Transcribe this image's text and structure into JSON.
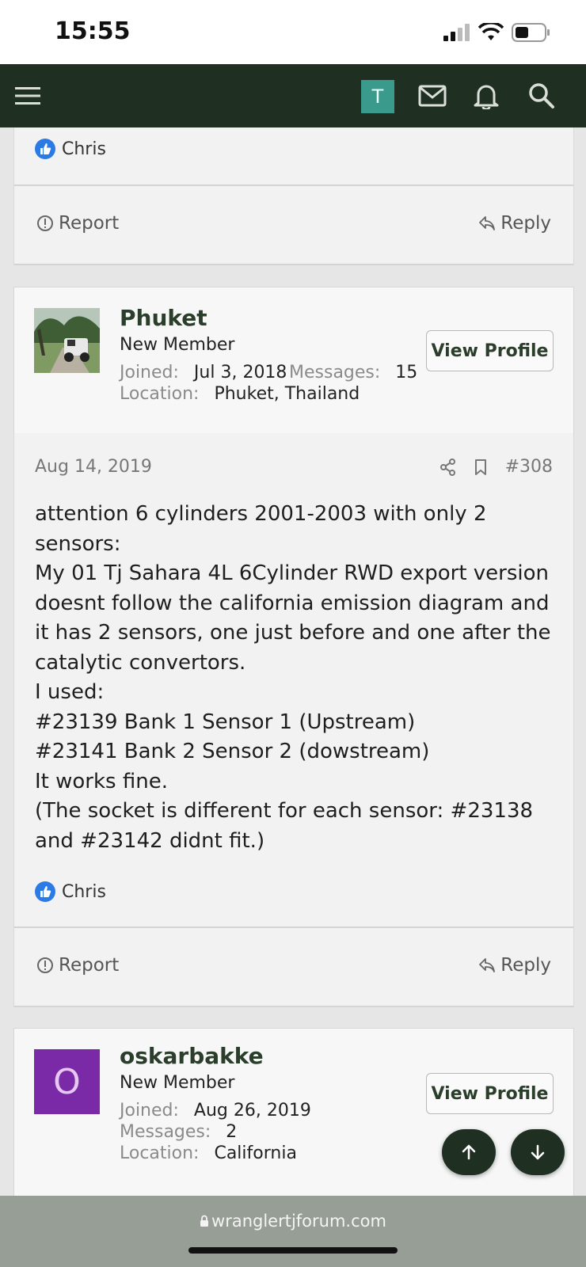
{
  "status": {
    "time": "15:55"
  },
  "header": {
    "user_initial": "T"
  },
  "prev_post": {
    "like_user": "Chris",
    "report_label": "Report",
    "reply_label": "Reply"
  },
  "post": {
    "author": {
      "name": "Phuket",
      "title": "New Member",
      "joined_label": "Joined:",
      "joined": "Jul 3, 2018",
      "messages_label": "Messages:",
      "messages": "15",
      "location_label": "Location:",
      "location": "Phuket, Thailand",
      "view_profile": "View Profile"
    },
    "date": "Aug 14, 2019",
    "number": "#308",
    "lines": [
      "attention 6 cylinders 2001-2003 with only 2",
      "sensors:",
      "My 01 Tj Sahara 4L 6Cylinder RWD export version",
      "doesnt follow the california emission diagram and",
      "it has 2 sensors, one just before and one after the",
      "catalytic convertors.",
      "I used:",
      "#23139 Bank 1 Sensor 1 (Upstream)",
      "#23141 Bank 2 Sensor 2 (dowstream)",
      "It works fine.",
      "(The socket is different for each sensor: #23138",
      "and #23142 didnt fit.)"
    ],
    "like_user": "Chris",
    "report_label": "Report",
    "reply_label": "Reply"
  },
  "next_author": {
    "initial": "O",
    "avatar_color": "#7a2aa6",
    "name": "oskarbakke",
    "title": "New Member",
    "joined_label": "Joined:",
    "joined": "Aug 26, 2019",
    "messages_label": "Messages:",
    "messages": "2",
    "location_label": "Location:",
    "location": "California",
    "view_profile": "View Profile"
  },
  "browser": {
    "url": "wranglertjforum.com"
  },
  "colors": {
    "topbar": "#1f2f22",
    "accent_name": "#2b3d2b",
    "avatar_t": "#3a9a8c",
    "like": "#2c7be5"
  },
  "icons": [
    "menu-icon",
    "mail-icon",
    "bell-icon",
    "search-icon",
    "thumbs-up-icon",
    "report-icon",
    "reply-icon",
    "share-icon",
    "bookmark-icon",
    "arrow-up-icon",
    "arrow-down-icon",
    "lock-icon"
  ]
}
